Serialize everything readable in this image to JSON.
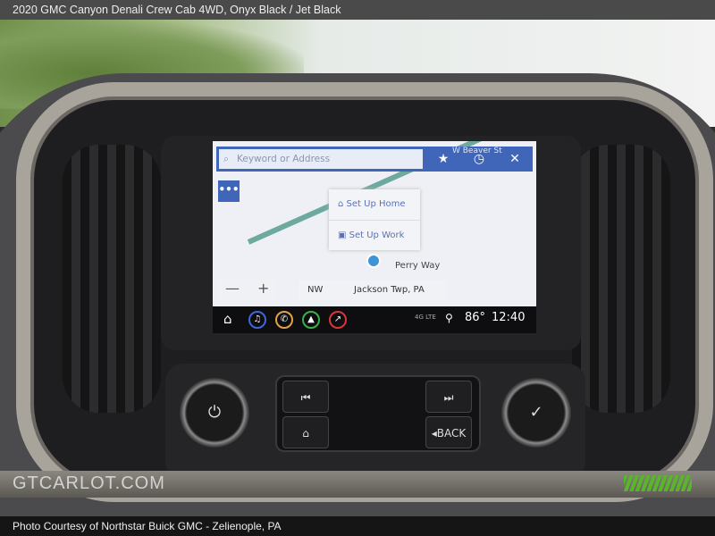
{
  "header": {
    "title": "2020 GMC Canyon Denali Crew Cab 4WD,   Onyx Black / Jet Black"
  },
  "screen": {
    "search_placeholder": "Keyword or Address",
    "popup": {
      "home": "Set Up Home",
      "work": "Set Up Work"
    },
    "more_label": "•••",
    "map": {
      "street_main": "Perry Way",
      "street_top": "W Beaver St"
    },
    "heading": "NW",
    "location": "Jackson Twp, PA",
    "zoom_out": "—",
    "zoom_in": "+",
    "status": {
      "network": "4G LTE",
      "temperature": "86°",
      "time": "12:40"
    },
    "accent": "#3f66b8"
  },
  "controls": {
    "prev": "⏮",
    "next": "⏭",
    "home": "⌂",
    "back": "◂BACK",
    "power": "⏻",
    "confirm": "✓"
  },
  "watermark": {
    "logo": "GTCARLOT.COM"
  },
  "footer": {
    "credit": "Photo Courtesy of Northstar Buick GMC - Zelienople, PA"
  }
}
